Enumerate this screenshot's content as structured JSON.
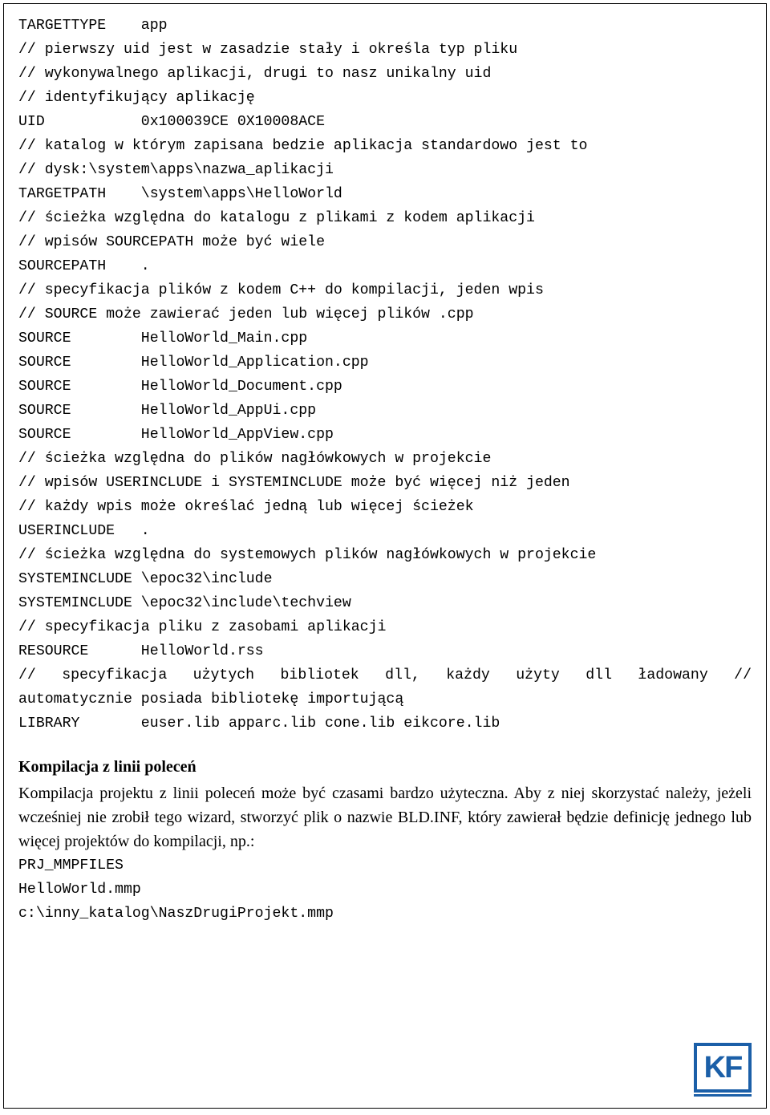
{
  "code": {
    "l1": "TARGETTYPE    app",
    "l2": "// pierwszy uid jest w zasadzie stały i określa typ pliku",
    "l3": "// wykonywalnego aplikacji, drugi to nasz unikalny uid",
    "l4": "// identyfikujący aplikację",
    "l5": "UID           0x100039CE 0X10008ACE",
    "l6": "// katalog w którym zapisana bedzie aplikacja standardowo jest to",
    "l7": "// dysk:\\system\\apps\\nazwa_aplikacji",
    "l8": "TARGETPATH    \\system\\apps\\HelloWorld",
    "l9": "// ścieżka względna do katalogu z plikami z kodem aplikacji",
    "l10": "// wpisów SOURCEPATH może być wiele",
    "l11": "SOURCEPATH    .",
    "l12": "// specyfikacja plików z kodem C++ do kompilacji, jeden wpis",
    "l13": "// SOURCE może zawierać jeden lub więcej plików .cpp",
    "l14": "SOURCE        HelloWorld_Main.cpp",
    "l15": "SOURCE        HelloWorld_Application.cpp",
    "l16": "SOURCE        HelloWorld_Document.cpp",
    "l17": "SOURCE        HelloWorld_AppUi.cpp",
    "l18": "SOURCE        HelloWorld_AppView.cpp",
    "l19": "// ścieżka względna do plików nagłówkowych w projekcie",
    "l20": "// wpisów USERINCLUDE i SYSTEMINCLUDE może być więcej niż jeden",
    "l21": "// każdy wpis może określać jedną lub więcej ścieżek",
    "l22": "USERINCLUDE   .",
    "l23": "// ścieżka względna do systemowych plików nagłówkowych w projekcie",
    "l24": "SYSTEMINCLUDE \\epoc32\\include",
    "l25": "SYSTEMINCLUDE \\epoc32\\include\\techview",
    "l26": "// specyfikacja pliku z zasobami aplikacji",
    "l27": "RESOURCE      HelloWorld.rss",
    "l28": "// specyfikacja użytych bibliotek dll, każdy użyty dll ładowany //",
    "l29": "automatycznie posiada bibliotekę importującą",
    "l30": "LIBRARY       euser.lib apparc.lib cone.lib eikcore.lib"
  },
  "section": {
    "heading": "Kompilacja z linii poleceń",
    "body": "Kompilacja projektu z linii poleceń może być czasami bardzo użyteczna. Aby z niej skorzystać należy, jeżeli wcześniej nie zrobił tego wizard, stworzyć plik o nazwie BLD.INF, który zawierał będzie definicję jednego lub więcej projektów do kompilacji, np.:"
  },
  "code2": {
    "l1": "PRJ_MMPFILES",
    "l2": "",
    "l3": "HelloWorld.mmp",
    "l4": "c:\\inny_katalog\\NaszDrugiProjekt.mmp"
  },
  "logo": "KF"
}
